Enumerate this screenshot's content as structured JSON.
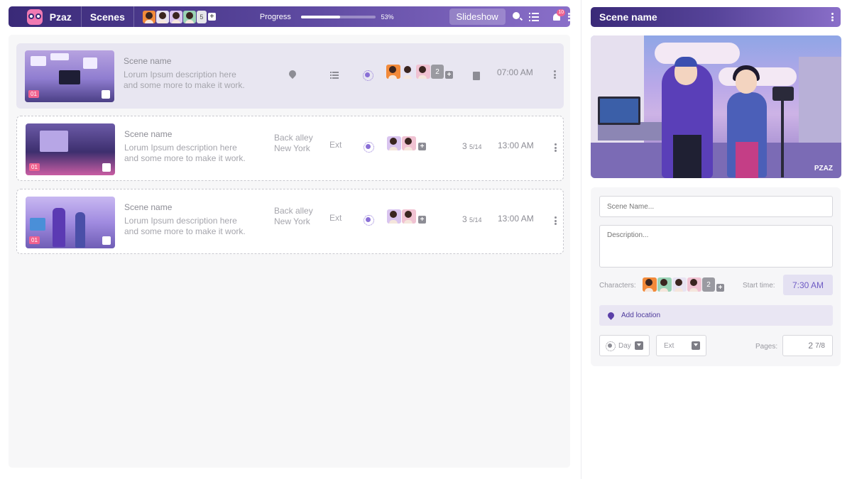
{
  "app": {
    "brand": "Pzaz",
    "section": "Scenes"
  },
  "header": {
    "collaborators_extra": "5",
    "progress_label": "Progress",
    "progress_value": 0.53,
    "progress_pct": "53%",
    "slideshow_label": "Slideshow",
    "notification_count": "10"
  },
  "scenes": [
    {
      "number": "01",
      "name": "Scene name",
      "description_line1": "Lorum Ipsum description here",
      "description_line2": "and some more to make it work.",
      "location_line1": "",
      "location_line2": "",
      "int_ext": "",
      "characters_extra": "2",
      "pages_whole": "",
      "pages_fraction": "",
      "time": "07:00 AM"
    },
    {
      "number": "01",
      "name": "Scene name",
      "description_line1": "Lorum Ipsum description here",
      "description_line2": "and some more to make it work.",
      "location_line1": "Back alley",
      "location_line2": "New York",
      "int_ext": "Ext",
      "characters_extra": "",
      "pages_whole": "3",
      "pages_fraction": "5/14",
      "time": "13:00 AM"
    },
    {
      "number": "01",
      "name": "Scene name",
      "description_line1": "Lorum Ipsum description here",
      "description_line2": "and some more to make it work.",
      "location_line1": "Back alley",
      "location_line2": "New York",
      "int_ext": "Ext",
      "characters_extra": "",
      "pages_whole": "3",
      "pages_fraction": "5/14",
      "time": "13:00 AM"
    }
  ],
  "detail": {
    "title": "Scene name",
    "watermark": "PZAZ",
    "scene_name_placeholder": "Scene Name...",
    "description_placeholder": "Description...",
    "characters_label": "Characters:",
    "characters_extra": "2",
    "start_time_label": "Start time:",
    "start_time": "7:30 AM",
    "add_location_label": "Add location",
    "day_label": "Day",
    "ext_label": "Ext",
    "pages_label": "Pages:",
    "pages_whole": "2",
    "pages_fraction": "7/8"
  },
  "colors": {
    "accent": "#3a2a78",
    "accent_light": "#8a6fc9",
    "badge": "#f0628f"
  },
  "icons": [
    "logo-icon",
    "search-icon",
    "list-icon",
    "bell-icon",
    "more-icon",
    "pin-icon",
    "sun-icon",
    "document-icon",
    "caret-down-icon"
  ]
}
